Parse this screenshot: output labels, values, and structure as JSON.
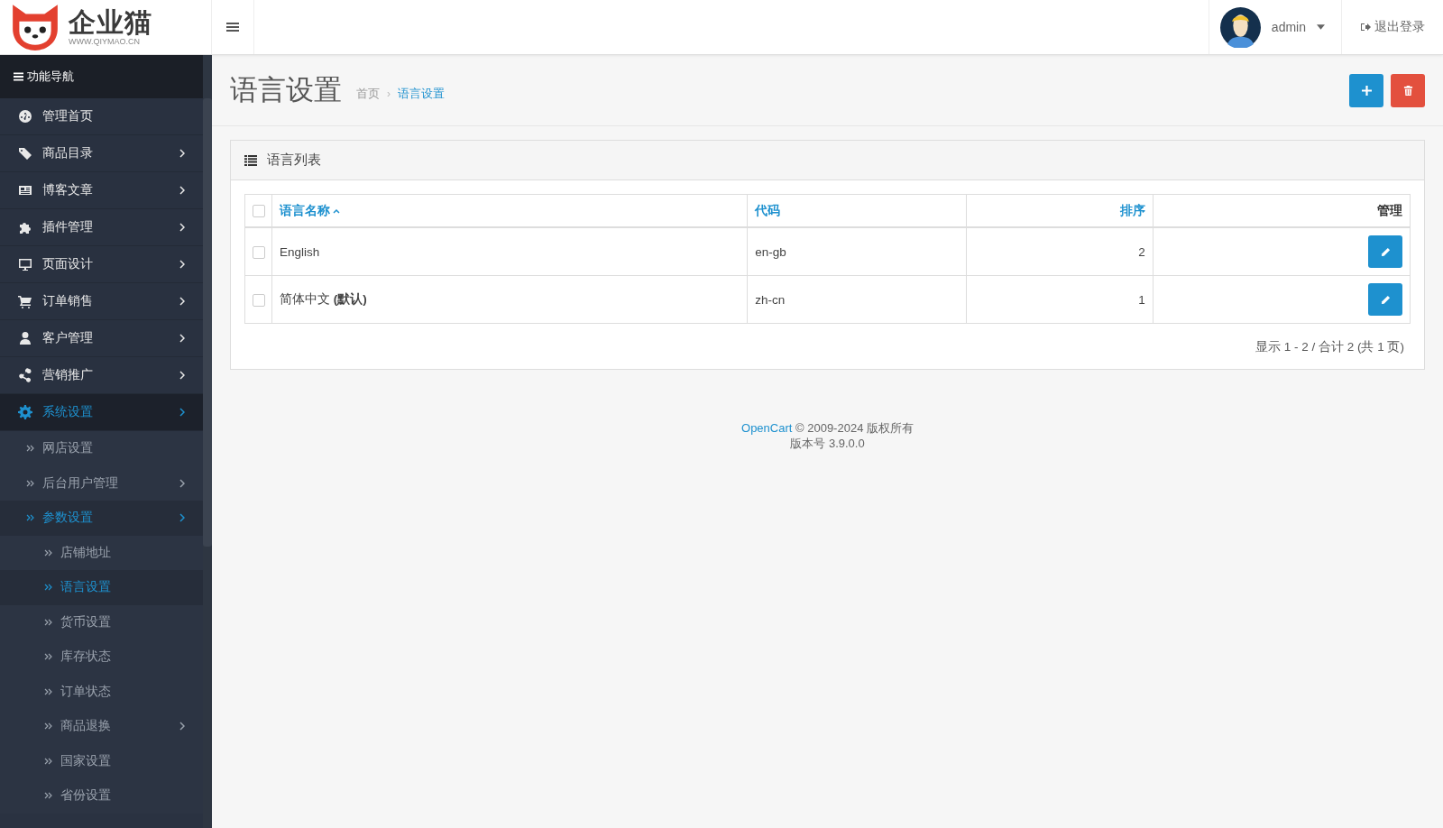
{
  "header": {
    "logo_text": "企业猫",
    "logo_url": "WWW.QIYMAO.CN",
    "user": "admin",
    "logout": "退出登录"
  },
  "sidebar": {
    "title": "功能导航",
    "items": [
      {
        "label": "管理首页",
        "kind": "dashboard",
        "selected": false,
        "submenu": false
      },
      {
        "label": "商品目录",
        "kind": "tags",
        "selected": false,
        "submenu": true
      },
      {
        "label": "博客文章",
        "kind": "newspaper",
        "selected": false,
        "submenu": true
      },
      {
        "label": "插件管理",
        "kind": "puzzle",
        "selected": false,
        "submenu": true
      },
      {
        "label": "页面设计",
        "kind": "desktop",
        "selected": false,
        "submenu": true
      },
      {
        "label": "订单销售",
        "kind": "cart",
        "selected": false,
        "submenu": true
      },
      {
        "label": "客户管理",
        "kind": "user",
        "selected": false,
        "submenu": true
      },
      {
        "label": "营销推广",
        "kind": "share",
        "selected": false,
        "submenu": true
      },
      {
        "label": "系统设置",
        "kind": "gear",
        "selected": true,
        "submenu": true,
        "children": [
          {
            "label": "网店设置",
            "selected": false,
            "submenu": false
          },
          {
            "label": "后台用户管理",
            "selected": false,
            "submenu": true
          },
          {
            "label": "参数设置",
            "selected": true,
            "submenu": true,
            "children": [
              {
                "label": "店铺地址",
                "selected": false,
                "submenu": false
              },
              {
                "label": "语言设置",
                "selected": true,
                "submenu": false
              },
              {
                "label": "货币设置",
                "selected": false,
                "submenu": false
              },
              {
                "label": "库存状态",
                "selected": false,
                "submenu": false
              },
              {
                "label": "订单状态",
                "selected": false,
                "submenu": false
              },
              {
                "label": "商品退换",
                "selected": false,
                "submenu": true
              },
              {
                "label": "国家设置",
                "selected": false,
                "submenu": false
              },
              {
                "label": "省份设置",
                "selected": false,
                "submenu": false
              }
            ]
          }
        ]
      }
    ]
  },
  "page": {
    "title": "语言设置",
    "separator": "›",
    "breadcrumb": [
      {
        "label": "首页",
        "selected": false
      },
      {
        "label": "语言设置",
        "selected": true
      }
    ]
  },
  "panel": {
    "title": "语言列表",
    "select_all": {
      "checked": false
    },
    "columns": [
      {
        "label": "语言名称",
        "sortable": true,
        "sorted": true
      },
      {
        "label": "代码",
        "sortable": true,
        "sorted": false
      },
      {
        "label": "排序",
        "sortable": true,
        "sorted": false
      },
      {
        "label": "管理",
        "sortable": false,
        "sorted": false
      }
    ],
    "rows": [
      {
        "checked": false,
        "name": "English",
        "code": "en-gb",
        "sort_order": "2"
      },
      {
        "checked": false,
        "name": "简体中文 **(默认)**",
        "code": "zh-cn",
        "sort_order": "1"
      }
    ],
    "summary": "显示 1 - 2 / 合计 2  (共 1 页)"
  },
  "footer": {
    "link": "OpenCart",
    "copyright": "© 2009-2024 版权所有",
    "version": "版本号 3.9.0.0"
  }
}
